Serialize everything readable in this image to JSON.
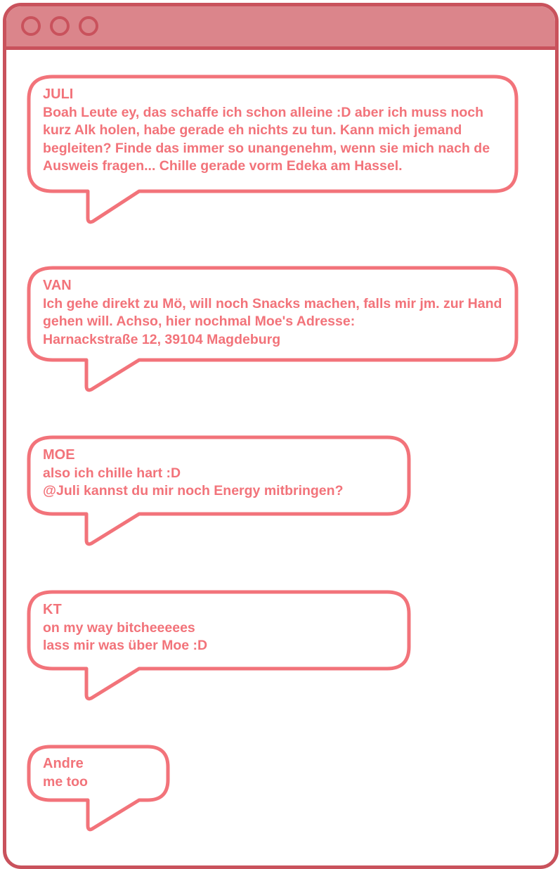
{
  "window": {
    "controls": [
      "close-icon",
      "minimize-icon",
      "maximize-icon"
    ]
  },
  "colors": {
    "frame": "#c9525c",
    "titlebar": "#db858b",
    "bubble_border": "#f2737a",
    "text": "#f2737a"
  },
  "messages": [
    {
      "sender": "JULI",
      "lines": [
        "Boah Leute ey, das schaffe ich schon alleine :D aber ich muss noch",
        "kurz Alk holen, habe gerade eh nichts zu tun. Kann mich jemand",
        "begleiten? Finde das immer so unangenehm, wenn sie mich nach de",
        "Ausweis fragen... Chille gerade vorm Edeka am Hassel."
      ]
    },
    {
      "sender": "VAN",
      "lines": [
        "Ich gehe direkt zu Mö, will noch Snacks machen, falls mir jm. zur Hand",
        "gehen will. Achso, hier nochmal Moe's Adresse:",
        "Harnackstraße 12, 39104 Magdeburg"
      ]
    },
    {
      "sender": "MOE",
      "lines": [
        "also ich chille hart :D",
        "@Juli kannst du mir noch Energy mitbringen?"
      ]
    },
    {
      "sender": "KT",
      "lines": [
        "on my way bitcheeeees",
        "lass mir was über Moe :D"
      ]
    },
    {
      "sender": "Andre",
      "lines": [
        "me too"
      ]
    }
  ]
}
